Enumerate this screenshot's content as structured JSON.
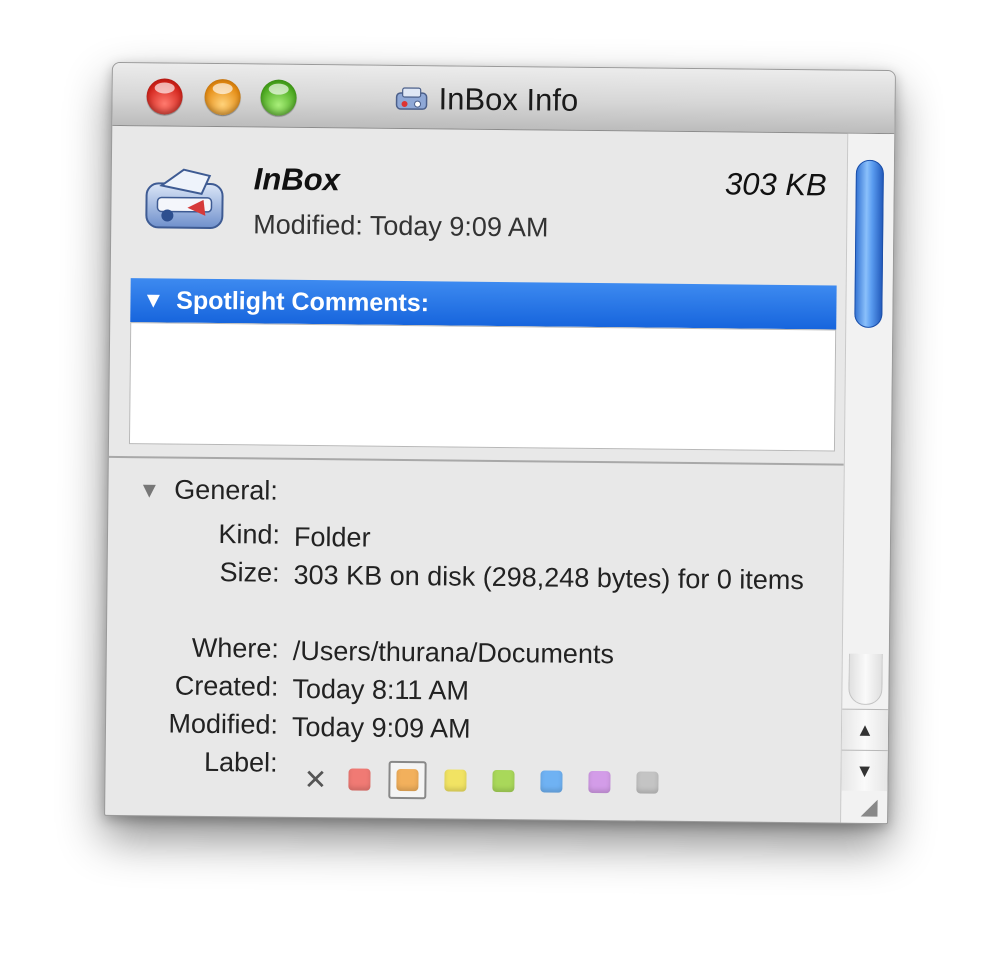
{
  "window": {
    "title": "InBox Info"
  },
  "header": {
    "name": "InBox",
    "size": "303 KB",
    "modified": "Modified: Today 9:09 AM"
  },
  "spotlight": {
    "label": "Spotlight Comments:",
    "comment": ""
  },
  "general": {
    "label": "General:",
    "rows": [
      {
        "label": "Kind:",
        "value": "Folder"
      },
      {
        "label": "Size:",
        "value": "303 KB on disk (298,248 bytes) for 0 items"
      },
      {
        "label": "Where:",
        "value": "/Users/thurana/Documents"
      },
      {
        "label": "Created:",
        "value": "Today 8:11 AM"
      },
      {
        "label": "Modified:",
        "value": "Today 9:09 AM"
      },
      {
        "label": "Label:",
        "value": ""
      }
    ],
    "label_colors": [
      "#f07a74",
      "#f2b05c",
      "#f1e363",
      "#a9d85a",
      "#6fb2f3",
      "#d39ce8",
      "#c4c4c4"
    ],
    "selected_label_index": 1
  },
  "icons": {
    "folder": "inbox-folder-icon",
    "clear_label": "x-icon",
    "resize": "resize-grip-icon"
  }
}
